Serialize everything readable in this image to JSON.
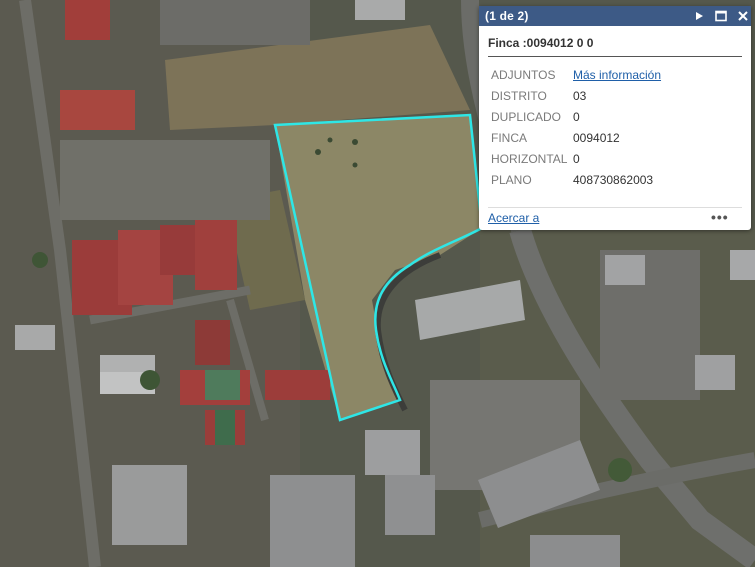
{
  "popup": {
    "counter": "(1 de 2)",
    "title": "Finca :0094012 0 0",
    "attributes": [
      {
        "key": "ADJUNTOS",
        "value": "Más información"
      },
      {
        "key": "DISTRITO",
        "value": "03"
      },
      {
        "key": "DUPLICADO",
        "value": "0"
      },
      {
        "key": "FINCA",
        "value": "0094012"
      },
      {
        "key": "HORIZONTAL",
        "value": "0"
      },
      {
        "key": "PLANO",
        "value": "408730862003"
      }
    ],
    "zoom_link": "Acercar a",
    "more_label": "•••",
    "icons": {
      "next": "next-arrow-icon",
      "maximize": "maximize-icon",
      "close": "close-icon",
      "more": "more-options-icon"
    }
  },
  "map": {
    "basemap": "aerial-imagery",
    "parcel_outline_color": "#2ee6e6",
    "header_color": "#3d5a86"
  }
}
